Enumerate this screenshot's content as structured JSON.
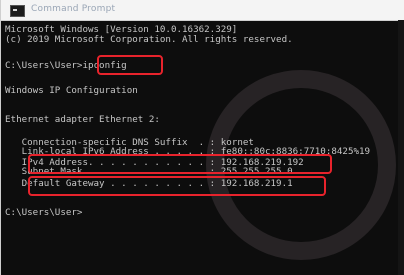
{
  "window": {
    "title": "Command Prompt"
  },
  "console": {
    "lines": [
      "Microsoft Windows [Version 10.0.16362.329]",
      "(c) 2019 Microsoft Corporation. All rights reserved.",
      "",
      "C:\\Users\\User>ipconfig",
      "",
      "Windows IP Configuration",
      "",
      "",
      "Ethernet adapter Ethernet 2:",
      "",
      "   Connection-specific DNS Suffix  . : kornet",
      "   Link-local IPv6 Address . . . . . : fe80::80c:8836:7710:8425%19",
      "   IPv4 Address. . . . . . . . . . . : 192.168.219.192",
      "   Subnet Mask . . . . . . . . . . . : 255.255.255.0",
      "   Default Gateway . . . . . . . . . : 192.168.219.1",
      "",
      "C:\\Users\\User>"
    ]
  },
  "highlight_color": "#e8232c"
}
